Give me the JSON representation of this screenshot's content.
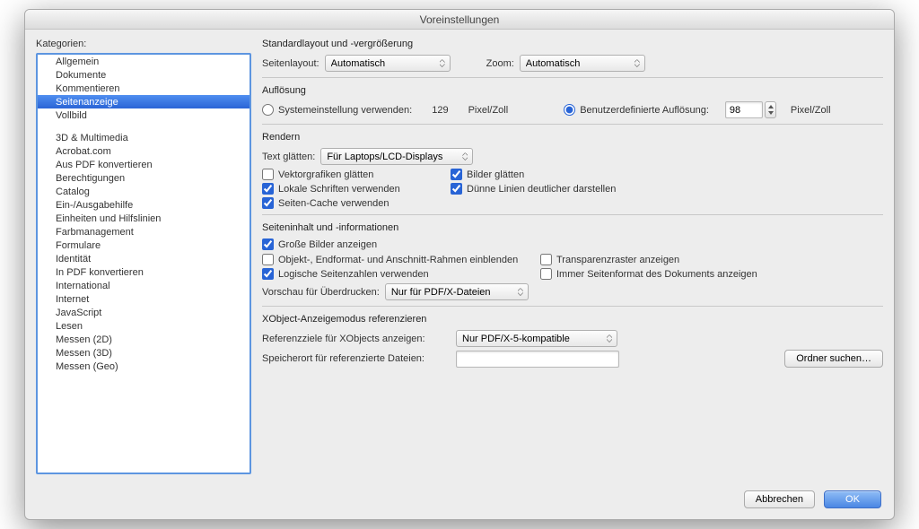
{
  "title": "Voreinstellungen",
  "categories_label": "Kategorien:",
  "categories_group1": [
    "Allgemein",
    "Dokumente",
    "Kommentieren",
    "Seitenanzeige",
    "Vollbild"
  ],
  "categories_group2": [
    "3D & Multimedia",
    "Acrobat.com",
    "Aus PDF konvertieren",
    "Berechtigungen",
    "Catalog",
    "Ein-/Ausgabehilfe",
    "Einheiten und Hilfslinien",
    "Farbmanagement",
    "Formulare",
    "Identität",
    "In PDF konvertieren",
    "International",
    "Internet",
    "JavaScript",
    "Lesen",
    "Messen (2D)",
    "Messen (3D)",
    "Messen (Geo)"
  ],
  "selected_category": "Seitenanzeige",
  "sec_layout": {
    "title": "Standardlayout und -vergrößerung",
    "page_layout_label": "Seitenlayout:",
    "page_layout_value": "Automatisch",
    "zoom_label": "Zoom:",
    "zoom_value": "Automatisch"
  },
  "sec_res": {
    "title": "Auflösung",
    "use_system": "Systemeinstellung verwenden:",
    "system_value": "129",
    "unit": "Pixel/Zoll",
    "custom_label": "Benutzerdefinierte Auflösung:",
    "custom_value": "98"
  },
  "sec_render": {
    "title": "Rendern",
    "smooth_text_label": "Text glätten:",
    "smooth_text_value": "Für Laptops/LCD-Displays",
    "c_vector": "Vektorgrafiken glätten",
    "c_images": "Bilder glätten",
    "c_localfonts": "Lokale Schriften verwenden",
    "c_thinlines": "Dünne Linien deutlicher darstellen",
    "c_pagecache": "Seiten-Cache verwenden"
  },
  "sec_content": {
    "title": "Seiteninhalt und -informationen",
    "c_largeimg": "Große Bilder anzeigen",
    "c_boxes": "Objekt-, Endformat- und Anschnitt-Rahmen einblenden",
    "c_transgrid": "Transparenzraster anzeigen",
    "c_logicalpages": "Logische Seitenzahlen verwenden",
    "c_always_docfmt": "Immer Seitenformat des Dokuments anzeigen",
    "overprint_label": "Vorschau für Überdrucken:",
    "overprint_value": "Nur für PDF/X-Dateien"
  },
  "sec_xobj": {
    "title": "XObject-Anzeigemodus referenzieren",
    "show_targets_label": "Referenzziele für XObjects anzeigen:",
    "show_targets_value": "Nur PDF/X-5-kompatible",
    "location_label": "Speicherort für referenzierte Dateien:",
    "browse_btn": "Ordner suchen…"
  },
  "footer": {
    "cancel": "Abbrechen",
    "ok": "OK"
  }
}
